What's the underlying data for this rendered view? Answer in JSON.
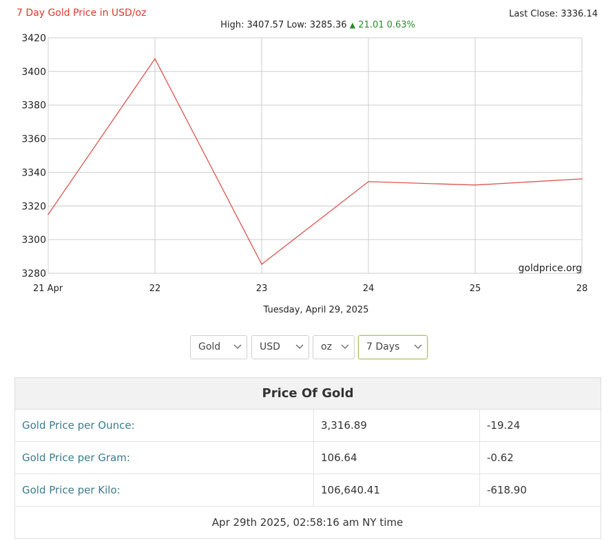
{
  "header": {
    "title": "7 Day Gold Price in USD/oz",
    "last_close": "Last Close: 3336.14",
    "high_low": "High: 3407.57 Low: 3285.36",
    "change": "21.01 0.63%"
  },
  "chart_data": {
    "type": "line",
    "title": "7 Day Gold Price in USD/oz",
    "x_ticks": [
      "21 Apr",
      "22",
      "23",
      "24",
      "25",
      "28"
    ],
    "x": [
      0,
      1,
      2,
      3,
      4,
      5
    ],
    "y_ticks": [
      3280,
      3300,
      3320,
      3340,
      3360,
      3380,
      3400,
      3420
    ],
    "ylim": [
      3280,
      3420
    ],
    "series": [
      {
        "values": [
          3315,
          3407.57,
          3285.36,
          3334.5,
          3332.5,
          3336.14
        ],
        "color": "#d9534f"
      }
    ],
    "watermark": "goldprice.org",
    "grid": true
  },
  "date_line": "Tuesday, April 29, 2025",
  "selectors": {
    "metal": "Gold",
    "currency": "USD",
    "unit": "oz",
    "period": "7 Days"
  },
  "table": {
    "heading": "Price Of Gold",
    "rows": [
      {
        "label": "Gold Price per Ounce:",
        "price": "3,316.89",
        "change": "-19.24"
      },
      {
        "label": "Gold Price per Gram:",
        "price": "106.64",
        "change": "-0.62"
      },
      {
        "label": "Gold Price per Kilo:",
        "price": "106,640.41",
        "change": "-618.90"
      }
    ],
    "footer": "Apr 29th 2025, 02:58:16 am NY time"
  }
}
